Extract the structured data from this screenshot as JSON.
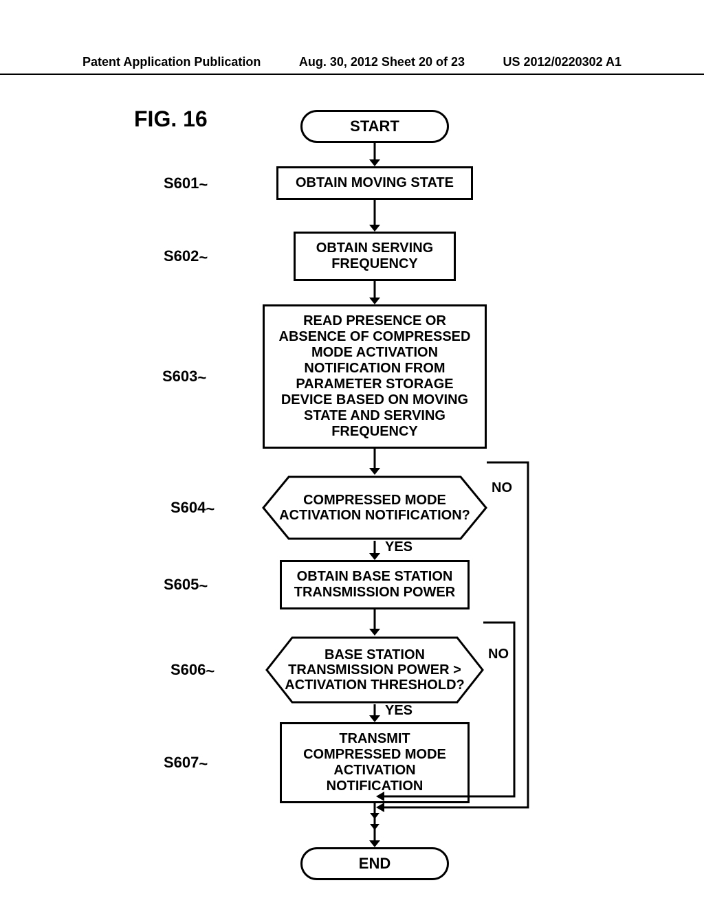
{
  "header": {
    "left": "Patent Application Publication",
    "center": "Aug. 30, 2012  Sheet 20 of 23",
    "right": "US 2012/0220302 A1"
  },
  "figure_title": "FIG. 16",
  "flow": {
    "start": "START",
    "end": "END",
    "yes": "YES",
    "no": "NO",
    "steps": {
      "s601": {
        "label": "S601",
        "text": "OBTAIN MOVING STATE"
      },
      "s602": {
        "label": "S602",
        "text": "OBTAIN SERVING FREQUENCY"
      },
      "s603": {
        "label": "S603",
        "text": "READ PRESENCE OR ABSENCE OF COMPRESSED MODE ACTIVATION NOTIFICATION FROM PARAMETER STORAGE DEVICE BASED ON MOVING STATE AND SERVING FREQUENCY"
      },
      "s604": {
        "label": "S604",
        "text": "COMPRESSED MODE ACTIVATION NOTIFICATION?"
      },
      "s605": {
        "label": "S605",
        "text": "OBTAIN BASE STATION TRANSMISSION POWER"
      },
      "s606": {
        "label": "S606",
        "text": "BASE STATION TRANSMISSION POWER > ACTIVATION THRESHOLD?"
      },
      "s607": {
        "label": "S607",
        "text": "TRANSMIT COMPRESSED MODE ACTIVATION NOTIFICATION"
      }
    }
  }
}
